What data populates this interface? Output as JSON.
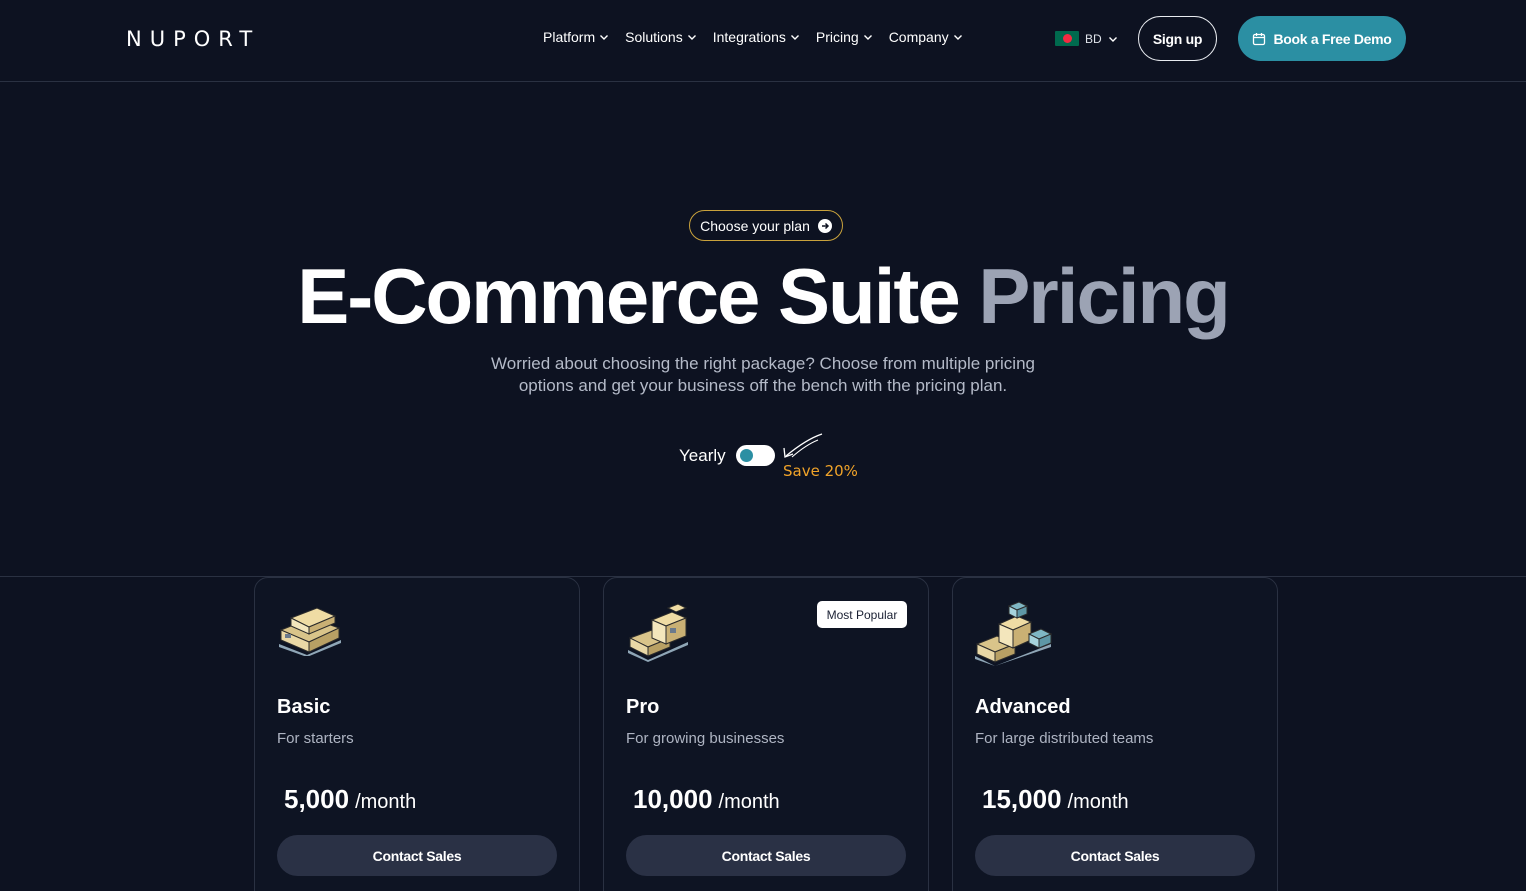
{
  "header": {
    "logo": "NUPORT",
    "nav": [
      {
        "label": "Platform"
      },
      {
        "label": "Solutions"
      },
      {
        "label": "Integrations"
      },
      {
        "label": "Pricing"
      },
      {
        "label": "Company"
      }
    ],
    "region": {
      "code": "BD",
      "flag_icon": "bangladesh-flag-icon"
    },
    "signup_label": "Sign up",
    "demo_label": "Book a Free Demo"
  },
  "hero": {
    "pill_label": "Choose your plan",
    "title_main": "E-Commerce Suite",
    "title_accent": "Pricing",
    "subtitle_line1": "Worried about choosing the right package? Choose from multiple pricing",
    "subtitle_line2": "options and get your business off the bench with the pricing plan.",
    "billing_label": "Yearly",
    "save_label": "Save 20%"
  },
  "plans": [
    {
      "name": "Basic",
      "desc": "For starters",
      "price": "5,000",
      "per": "/month",
      "cta": "Contact Sales",
      "icon": "box-stack-small-icon"
    },
    {
      "name": "Pro",
      "desc": "For growing businesses",
      "price": "10,000",
      "per": "/month",
      "cta": "Contact Sales",
      "badge": "Most Popular",
      "icon": "box-stack-medium-icon"
    },
    {
      "name": "Advanced",
      "desc": "For large distributed teams",
      "price": "15,000",
      "per": "/month",
      "cta": "Contact Sales",
      "icon": "box-stack-large-icon"
    }
  ],
  "colors": {
    "background": "#0d1221",
    "accent_teal": "#2b8fa3",
    "accent_gold": "#f0a329",
    "muted_title": "#9ca3b4",
    "card_button": "#2a3145"
  }
}
